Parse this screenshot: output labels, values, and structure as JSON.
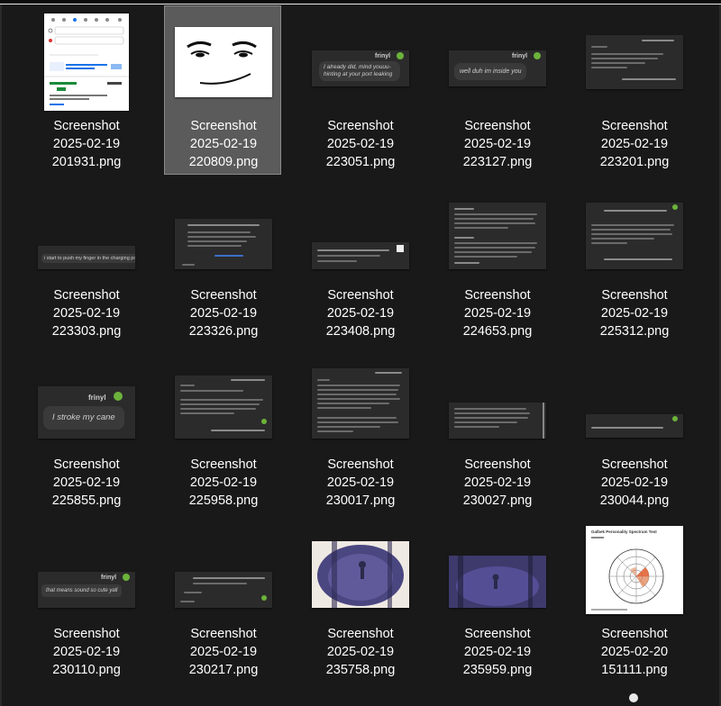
{
  "window": {
    "title": ""
  },
  "files": [
    {
      "line1": "Screenshot",
      "line2": "2025-02-19",
      "line3": "201931.png",
      "kind": "maps",
      "selected": false
    },
    {
      "line1": "Screenshot",
      "line2": "2025-02-19",
      "line3": "220809.png",
      "kind": "face",
      "selected": true
    },
    {
      "line1": "Screenshot",
      "line2": "2025-02-19",
      "line3": "223051.png",
      "kind": "chat-text",
      "bubble": "I already did, mind youuu-\nhinting at your port leaking",
      "selected": false
    },
    {
      "line1": "Screenshot",
      "line2": "2025-02-19",
      "line3": "223127.png",
      "kind": "chat-text",
      "bubble": "well duh im inside you",
      "selected": false
    },
    {
      "line1": "Screenshot",
      "line2": "2025-02-19",
      "line3": "223201.png",
      "kind": "chat-lines",
      "selected": false
    },
    {
      "line1": "Screenshot",
      "line2": "2025-02-19",
      "line3": "223303.png",
      "kind": "chat-text",
      "bubble": "i start to push my finger in the charging port",
      "selected": false
    },
    {
      "line1": "Screenshot",
      "line2": "2025-02-19",
      "line3": "223326.png",
      "kind": "chat-lines",
      "selected": false
    },
    {
      "line1": "Screenshot",
      "line2": "2025-02-19",
      "line3": "223408.png",
      "kind": "chat-lines",
      "selected": false
    },
    {
      "line1": "Screenshot",
      "line2": "2025-02-19",
      "line3": "224653.png",
      "kind": "chat-lines",
      "selected": false
    },
    {
      "line1": "Screenshot",
      "line2": "2025-02-19",
      "line3": "225312.png",
      "kind": "chat-lines",
      "selected": false
    },
    {
      "line1": "Screenshot",
      "line2": "2025-02-19",
      "line3": "225855.png",
      "kind": "chat-text",
      "bubble": "I stroke my cane",
      "selected": false
    },
    {
      "line1": "Screenshot",
      "line2": "2025-02-19",
      "line3": "225958.png",
      "kind": "chat-lines",
      "selected": false
    },
    {
      "line1": "Screenshot",
      "line2": "2025-02-19",
      "line3": "230017.png",
      "kind": "chat-lines",
      "selected": false
    },
    {
      "line1": "Screenshot",
      "line2": "2025-02-19",
      "line3": "230027.png",
      "kind": "chat-lines",
      "selected": false
    },
    {
      "line1": "Screenshot",
      "line2": "2025-02-19",
      "line3": "230044.png",
      "kind": "chat-lines",
      "selected": false
    },
    {
      "line1": "Screenshot",
      "line2": "2025-02-19",
      "line3": "230110.png",
      "kind": "chat-text",
      "bubble": "that means sound so cute yall",
      "selected": false
    },
    {
      "line1": "Screenshot",
      "line2": "2025-02-19",
      "line3": "230217.png",
      "kind": "chat-lines",
      "selected": false
    },
    {
      "line1": "Screenshot",
      "line2": "2025-02-19",
      "line3": "235758.png",
      "kind": "scene-light",
      "selected": false
    },
    {
      "line1": "Screenshot",
      "line2": "2025-02-19",
      "line3": "235959.png",
      "kind": "scene-dark",
      "selected": false
    },
    {
      "line1": "Screenshot",
      "line2": "2025-02-20",
      "line3": "151111.png",
      "kind": "spectrum",
      "title": "Galbek Personality Spectrum Test",
      "selected": false
    }
  ],
  "chat_name": "frinyl",
  "colors": {
    "background": "#191919",
    "selection": "#5b5b5b",
    "selection_border": "#8a8a8a",
    "text": "#ffffff",
    "chat_bg": "#2b2b2b",
    "bubble": "#3a3a3a",
    "online_dot": "#6bb33a",
    "scene_purple": "#4a4680"
  }
}
